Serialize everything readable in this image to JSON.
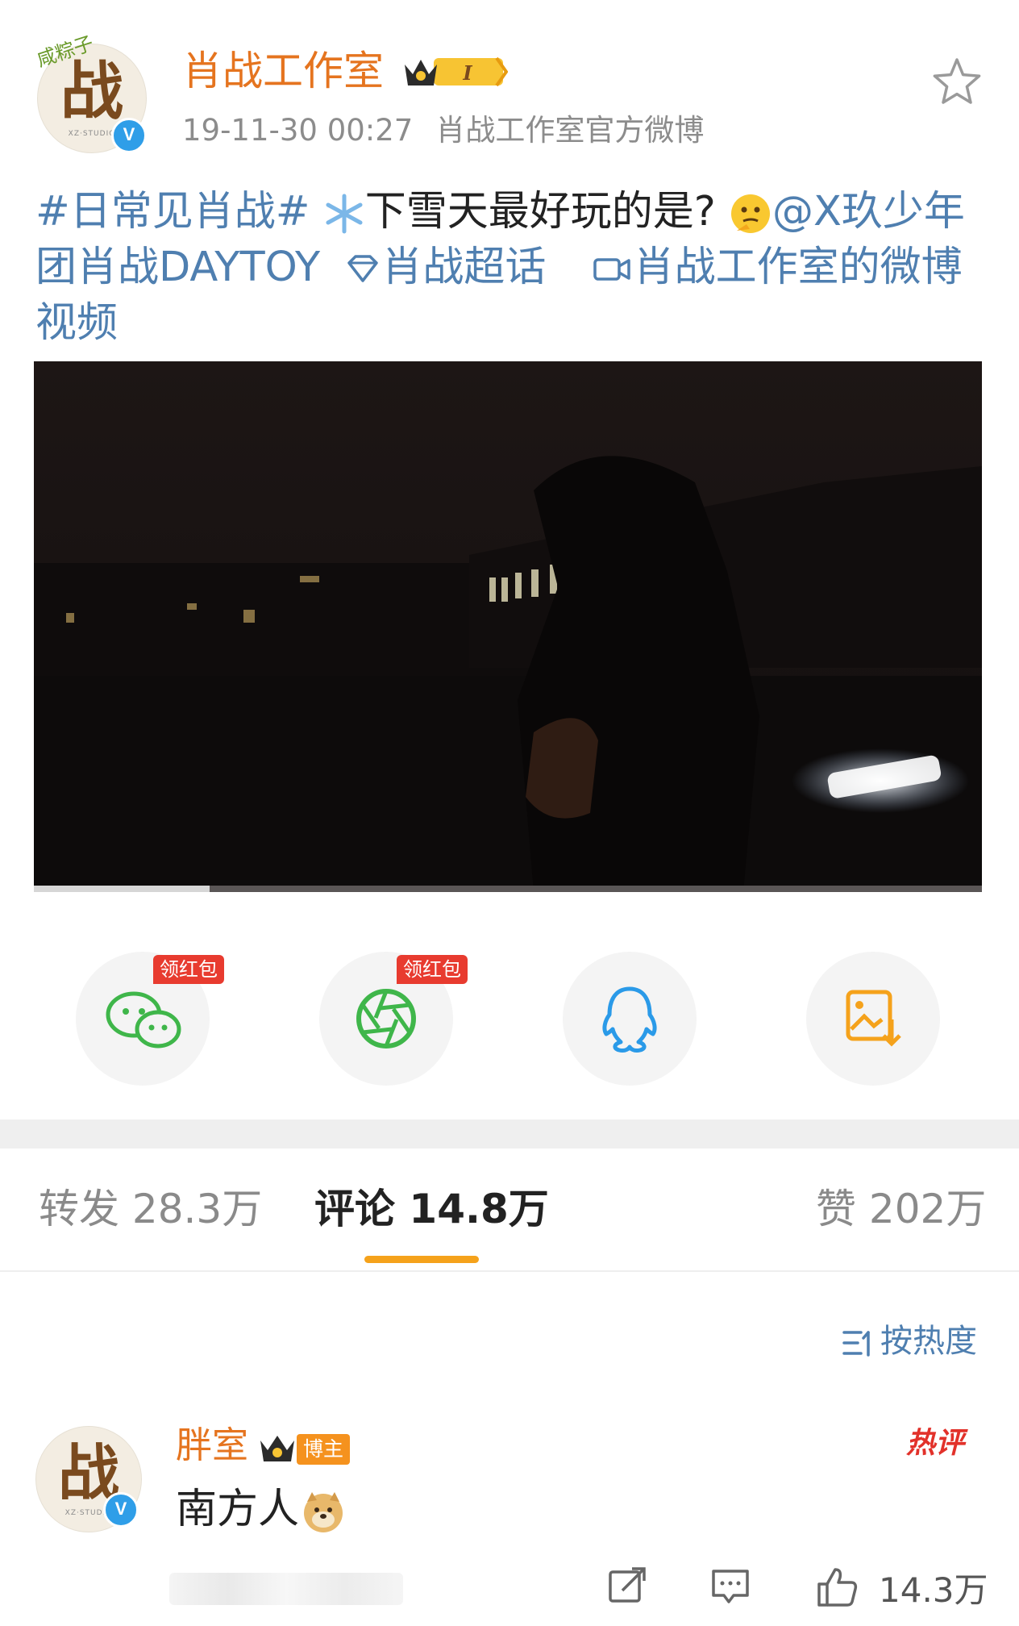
{
  "header": {
    "username": "肖战工作室",
    "avatar_tag": "咸粽子",
    "avatar_char": "战",
    "avatar_sub": "XZ·STUDIO",
    "verified_mark": "V",
    "member_level": "I",
    "timestamp": "19-11-30 00:27",
    "source": "肖战工作室官方微博"
  },
  "post": {
    "hashtag": "#日常见肖战#",
    "text": "下雪天最好玩的是?",
    "mention": "@X玖少年团肖战DAYTOY",
    "supertopic": "肖战超话",
    "video_link": "肖战工作室的微博视频"
  },
  "video": {
    "progress": 0.185
  },
  "share": {
    "wechat_badge": "领红包",
    "moments_badge": "领红包",
    "icons": [
      "wechat-icon",
      "moments-icon",
      "qq-icon",
      "save-image-icon"
    ]
  },
  "tabs": {
    "repost": "转发 28.3万",
    "comment": "评论 14.8万",
    "like": "赞 202万"
  },
  "sort_label": "按热度",
  "comment": {
    "user": "胖室",
    "role_badge": "博主",
    "hot_label": "热评",
    "text": "南方人",
    "like_count": "14.3万"
  },
  "colors": {
    "username": "#e5741f",
    "link": "#4f7fb0",
    "tab_underline": "#f5a21b",
    "verified": "#2f9ee8",
    "redpack": "#e83b2f"
  }
}
